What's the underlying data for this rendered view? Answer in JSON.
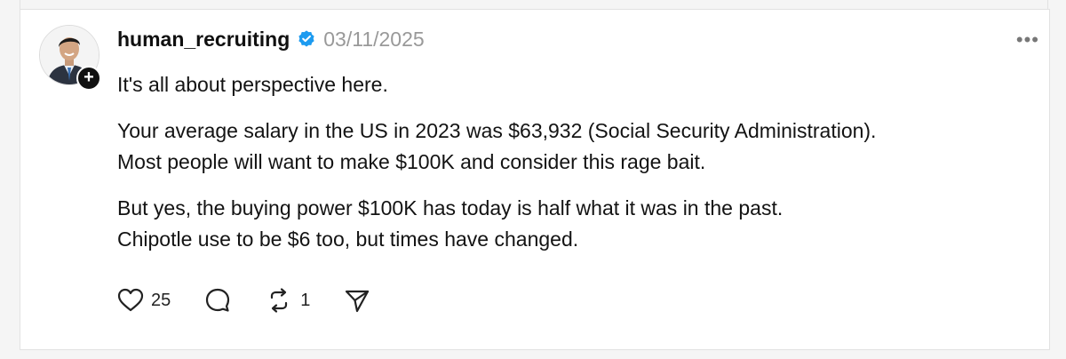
{
  "post": {
    "username": "human_recruiting",
    "date": "03/11/2025",
    "paragraphs": [
      "It's all about perspective here.",
      "Your average salary in the US in 2023 was $63,932 (Social Security Administration). Most people will want to make $100K and consider this rage bait.",
      "But yes, the buying power $100K has today is half what it was in the past. Chipotle use to be $6 too, but times have changed."
    ],
    "lines": {
      "p2_l1": "Your average salary in the US in 2023 was $63,932 (Social Security Administration).",
      "p2_l2": "Most people will want to make $100K and consider this rage bait.",
      "p3_l1": "But yes, the buying power $100K has today is half what it was in the past.",
      "p3_l2": "Chipotle use to be $6 too, but times have changed."
    },
    "actions": {
      "like_count": "25",
      "repost_count": "1"
    }
  },
  "icons": {
    "verified": "verified-badge-icon",
    "follow": "plus-icon",
    "more": "more-horizontal-icon",
    "like": "heart-icon",
    "comment": "comment-icon",
    "repost": "repost-icon",
    "share": "send-icon"
  },
  "colors": {
    "verified_blue": "#1d9bf0",
    "date_gray": "#999999"
  }
}
